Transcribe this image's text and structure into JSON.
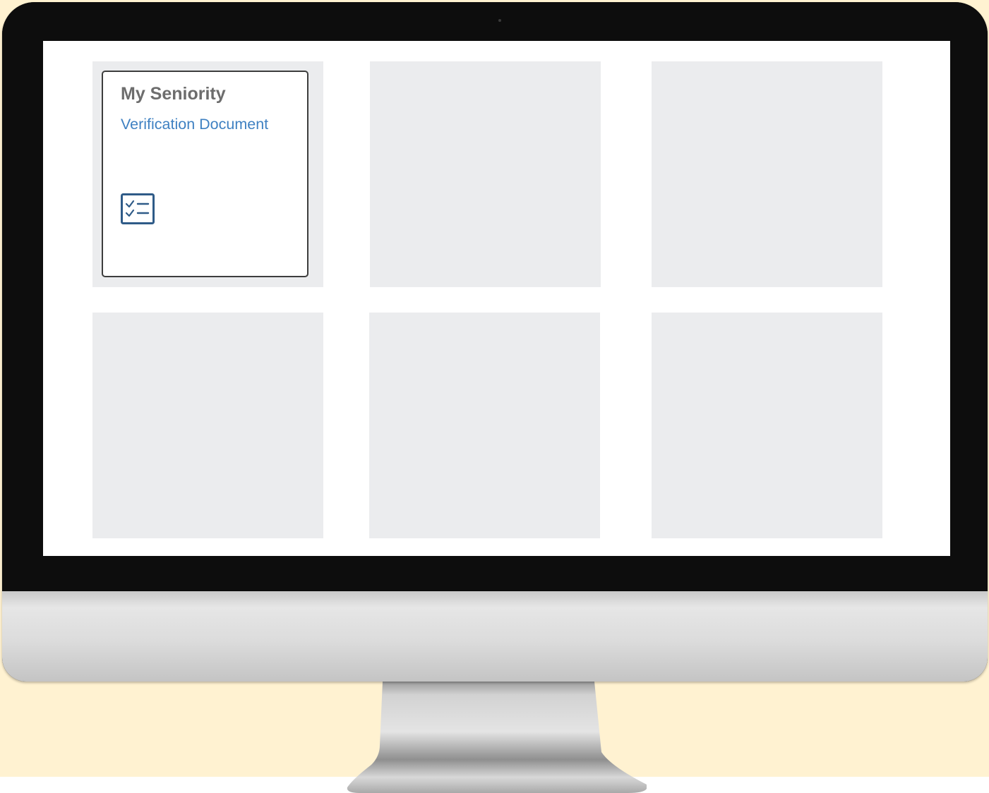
{
  "tile": {
    "title": "My Seniority",
    "subtitle": "Verification Document",
    "icon": "task-list-icon"
  },
  "colors": {
    "backdrop": "#fff2d1",
    "tile_placeholder": "#ebecee",
    "title": "#6d6d6d",
    "subtitle": "#3f81c2",
    "icon": "#2f5b88"
  }
}
